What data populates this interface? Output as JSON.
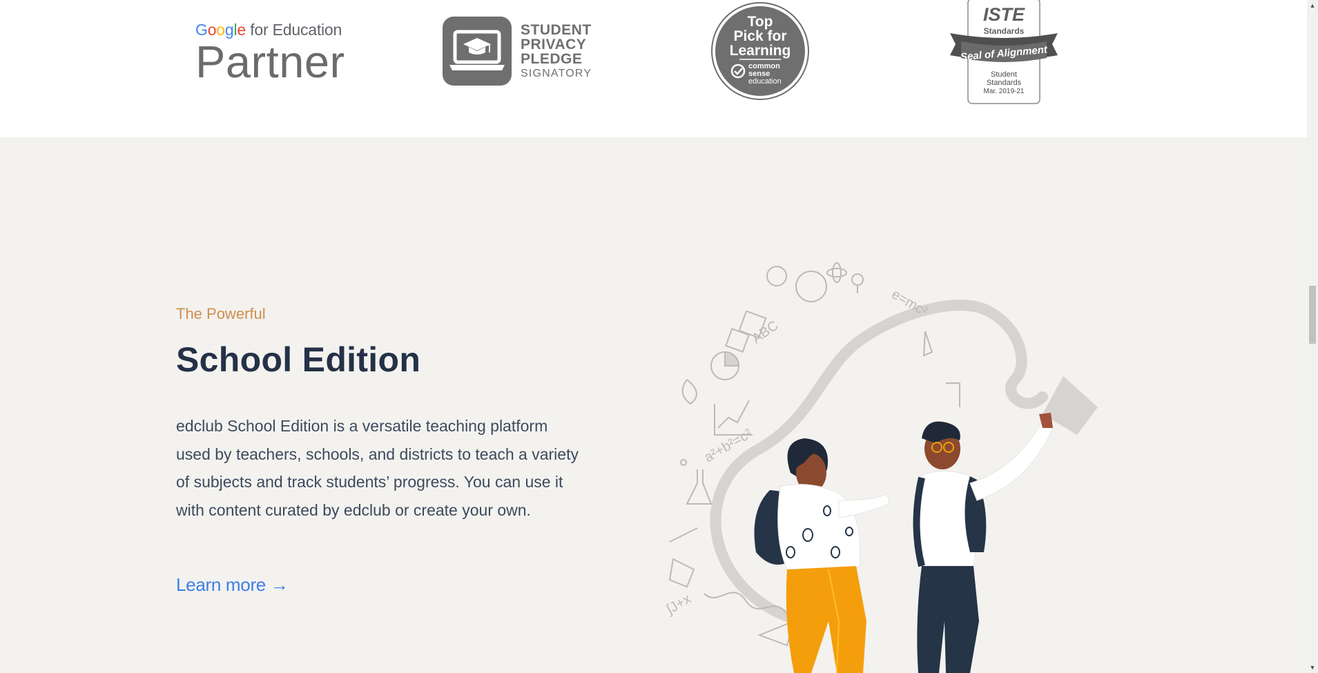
{
  "badges": {
    "google": {
      "top_letters": [
        "G",
        "o",
        "o",
        "g",
        "l",
        "e"
      ],
      "top_suffix": " for Education",
      "bottom": "Partner"
    },
    "student_privacy": {
      "line1": "STUDENT",
      "line2": "PRIVACY",
      "line3": "PLEDGE",
      "line4": "SIGNATORY",
      "icon": "laptop-graduation-cap-icon"
    },
    "top_pick": {
      "line1": "Top",
      "line2": "Pick for",
      "line3": "Learning",
      "sub1": "common",
      "sub2": "sense",
      "sub3": "education"
    },
    "iste": {
      "logo": "ISTE",
      "standards": "Standards",
      "ribbon": "Seal of Alignment",
      "line1": "Student",
      "line2": "Standards",
      "line3": "Mar. 2019-21"
    }
  },
  "hero": {
    "eyebrow": "The Powerful",
    "title": "School Edition",
    "description": "edclub School Edition is a versatile teaching platform used by teachers, schools, and districts to teach a variety of subjects and track students’ progress. You can use it with content curated by edclub or create your own.",
    "cta_label": "Learn more",
    "cta_arrow": "→"
  },
  "illustration": {
    "equations": [
      "a²+b²=c²",
      "e=mc²",
      "ABC",
      "∫J+x"
    ]
  },
  "colors": {
    "accent": "#cf8e4c",
    "title": "#243147",
    "link": "#3f7ee8",
    "background": "#f3f2ef"
  }
}
